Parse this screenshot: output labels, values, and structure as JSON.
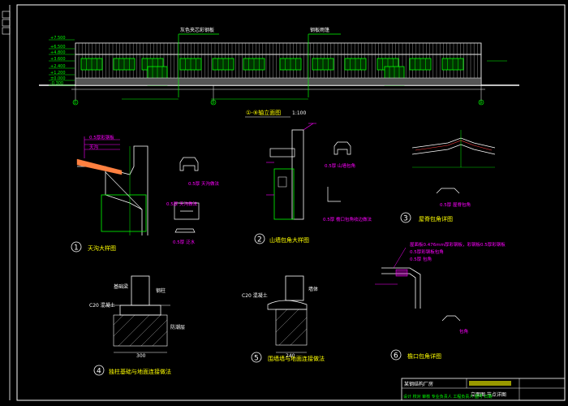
{
  "drawing": {
    "elevation": {
      "title": "①-⑨轴立面图",
      "scale": "1:100",
      "callout_left": "灰色夹芯彩钢板",
      "callout_right": "钢板雨篷",
      "levels": [
        "+7.500",
        "+6.500",
        "+4.800",
        "+3.600",
        "+2.400",
        "+1.200",
        "±0.000",
        "-0.300"
      ],
      "axis_left": "①",
      "axis_mid": "⑤",
      "axis_right": "⑨"
    },
    "details": [
      {
        "num": "1",
        "title": "天沟大样图"
      },
      {
        "num": "2",
        "title": "山墙包角大样图"
      },
      {
        "num": "3",
        "title": "屋脊包角详图"
      },
      {
        "num": "4",
        "title": "独柱基础与地面连接做法"
      },
      {
        "num": "5",
        "title": "围墙墙与地面连接做法"
      },
      {
        "num": "6",
        "title": "檐口包角详图"
      }
    ],
    "detail_labels": {
      "gutter": "天沟",
      "gutter_note": "0.5厚彩钢板",
      "d1_sub1": "0.5厚 天沟做法",
      "d1_sub2": "0.5厚 天沟做法",
      "d1_sub3": "0.5厚 泛水",
      "d2_sub1": "0.5厚 山墙包角",
      "d2_sub2": "0.5厚 檐口包角收边做法",
      "d3_sub1": "0.5厚 屋脊包角",
      "d4_label1": "C20 混凝土",
      "d4_label2": "基础梁",
      "d4_label3": "钢柱",
      "d4_label4": "防潮层",
      "d4_dim": "300",
      "d5_label1": "C20 混凝土",
      "d5_label2": "墙体",
      "d5_dim": "240",
      "d6_note1": "屋面板0.476mm厚彩钢板，彩钢板0.5厚彩钢板",
      "d6_note2": "0.5厚彩钢板包角",
      "d6_note3": "0.5厚 包角",
      "d6_sub": "包角"
    },
    "title_block": {
      "project": "某钢结构厂房",
      "drawing_name": "立面图 节点详图",
      "footer": "设计 校对 审核 专业负责人 工程负责人 图号 日期"
    }
  }
}
